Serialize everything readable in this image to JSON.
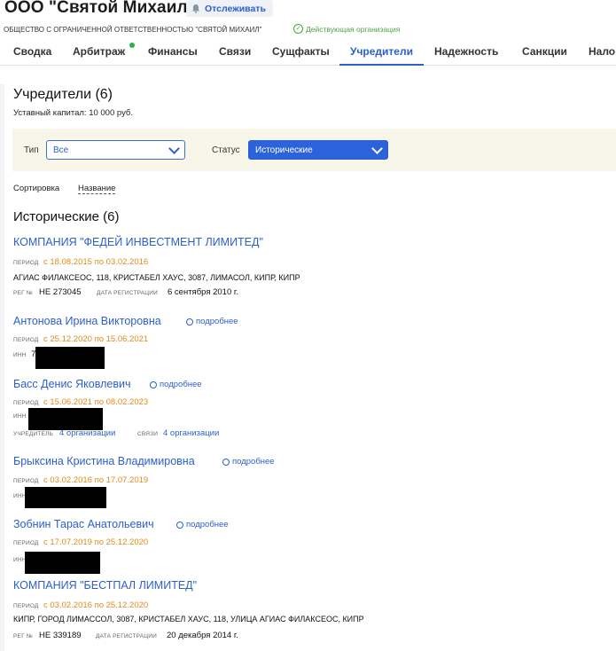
{
  "header": {
    "company_title": "ООО \"Святой Михаил\"",
    "track_label": "Отслеживать",
    "full_name": "ОБЩЕСТВО С ОГРАНИЧЕННОЙ ОТВЕТСТВЕННОСТЬЮ \"СВЯТОЙ МИХАИЛ\"",
    "status": "Действующая организация"
  },
  "tabs": [
    "Сводка",
    "Арбитраж",
    "Финансы",
    "Связи",
    "Сущфакты",
    "Учредители",
    "Надежность",
    "Санкции",
    "Нало"
  ],
  "active_tab": "Учредители",
  "section": {
    "title": "Учредители (6)",
    "capital": "Уставный капитал: 10 000 руб."
  },
  "filters": {
    "type_label": "Тип",
    "type_value": "Все",
    "status_label": "Статус",
    "status_value": "Исторические"
  },
  "sort": {
    "label": "Сортировка",
    "value": "Название"
  },
  "group_title": "Исторические (6)",
  "labels": {
    "period": "период",
    "reg_no": "рег №",
    "reg_date": "дата регистрации",
    "inn": "инн",
    "founder": "учредитель",
    "links": "связи",
    "more": "подробнее"
  },
  "entries": [
    {
      "name": "КОМПАНИЯ \"ФЕДЕЙ ИНВЕСТМЕНТ ЛИМИТЕД\"",
      "period": "с 18.08.2015 по 03.02.2016",
      "address": "АГИАС ФИЛАКСЕОС, 118, КРИСТАБЕЛ ХАУС, 3087, ЛИМАСОЛ, КИПР, КИПР",
      "reg_no": "НЕ 273045",
      "reg_date": "6 сентября 2010 г."
    },
    {
      "name": "Антонова Ирина Викторовна",
      "period": "с 25.12.2020 по 15.06.2021",
      "inn_visible": "7"
    },
    {
      "name": "Басс Денис Яковлевич",
      "period": "с 15.06.2021 по 08.02.2023",
      "founder_of": "4 организации",
      "links": "4 организации"
    },
    {
      "name": "Брыксина Кристина Владимировна",
      "period": "с 03.02.2016 по 17.07.2019"
    },
    {
      "name": "Зобнин Тарас Анатольевич",
      "period": "с 17.07.2019 по 25.12.2020"
    },
    {
      "name": "КОМПАНИЯ \"БЕСТПАЛ ЛИМИТЕД\"",
      "period": "с 03.02.2016 по 25.12.2020",
      "address": "КИПР, ГОРОД ЛИМАССОЛ, 3087, КРИСТАБЕЛ ХАУС, 118, УЛИЦА АГИАС ФИЛАКСЕОС, КИПР",
      "reg_no": "НЕ 339189",
      "reg_date": "20 декабря 2014 г."
    }
  ]
}
